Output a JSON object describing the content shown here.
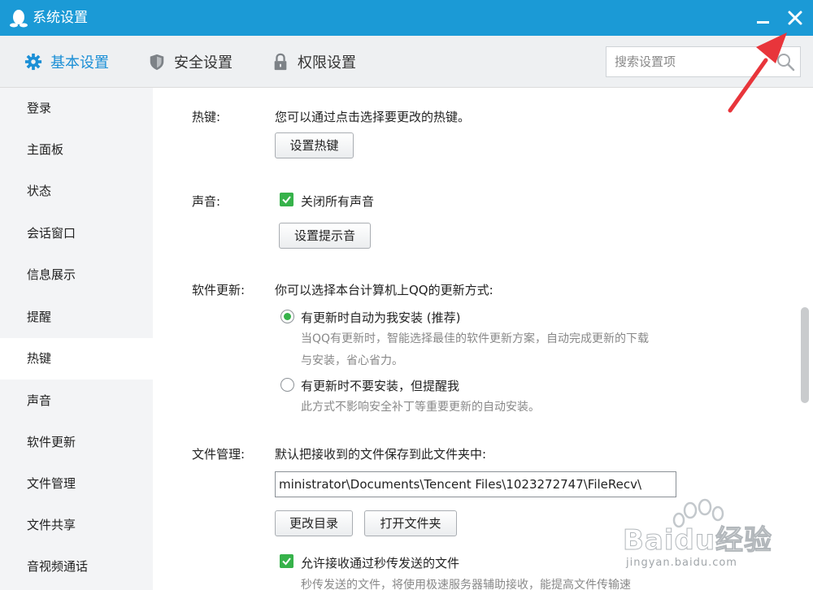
{
  "window": {
    "title": "系统设置",
    "close_accent": "#e8353b"
  },
  "tabs": [
    {
      "label": "基本设置",
      "icon": "gear-icon",
      "active": true
    },
    {
      "label": "安全设置",
      "icon": "shield-icon",
      "active": false
    },
    {
      "label": "权限设置",
      "icon": "lock-icon",
      "active": false
    }
  ],
  "search": {
    "placeholder": "搜索设置项",
    "icon": "search-icon"
  },
  "sidebar": {
    "items": [
      {
        "label": "登录"
      },
      {
        "label": "主面板"
      },
      {
        "label": "状态"
      },
      {
        "label": "会话窗口"
      },
      {
        "label": "信息展示"
      },
      {
        "label": "提醒"
      },
      {
        "label": "热键",
        "active": true
      },
      {
        "label": "声音"
      },
      {
        "label": "软件更新"
      },
      {
        "label": "文件管理"
      },
      {
        "label": "文件共享"
      },
      {
        "label": "音视频通话"
      }
    ]
  },
  "hotkey": {
    "label": "热键:",
    "description": "您可以通过点击选择要更改的热键。",
    "button": "设置热键"
  },
  "sound": {
    "label": "声音:",
    "mute_all_label": "关闭所有声音",
    "mute_all_checked": true,
    "button": "设置提示音"
  },
  "update": {
    "label": "软件更新:",
    "description": "你可以选择本台计算机上QQ的更新方式:",
    "option_auto": {
      "label": "有更新时自动为我安装 (推荐)",
      "selected": true,
      "desc_line1": "当QQ有更新时，智能选择最佳的软件更新方案，自动完成更新的下载",
      "desc_line2": "与安装，省心省力。"
    },
    "option_notify": {
      "label": "有更新时不要安装，但提醒我",
      "selected": false,
      "desc": "此方式不影响安全补丁等重要更新的自动安装。"
    }
  },
  "files": {
    "label": "文件管理:",
    "description": "默认把接收到的文件保存到此文件夹中:",
    "path": "ministrator\\Documents\\Tencent Files\\1023272747\\FileRecv\\",
    "change_dir_button": "更改目录",
    "open_folder_button": "打开文件夹",
    "fast_transfer_label": "允许接收通过秒传发送的文件",
    "fast_transfer_checked": true,
    "fast_transfer_desc": "秒传发送的文件，将使用极速服务器辅助接收，能提高文件传输速"
  },
  "watermark": {
    "brand": "Baidu经验",
    "url": "jingyan.baidu.com"
  }
}
